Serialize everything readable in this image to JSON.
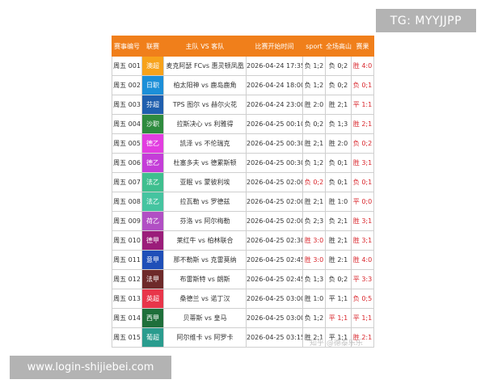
{
  "badges": {
    "tg": "TG: MYYJJPP",
    "url": "www.login-shijiebei.com"
  },
  "watermark": "知乎 @德泰乐乐",
  "table": {
    "headers": [
      "赛事编号",
      "联赛",
      "主队 VS 客队",
      "比赛开始时间",
      "sport",
      "全场高山",
      "赛果"
    ],
    "rows": [
      {
        "id": "周五 001",
        "league": "澳超",
        "color": "#f7a21b",
        "match": "麦克阿瑟 FCvs 惠灵顿凤凰",
        "time": "2026-04-24 17:35",
        "sport": "负 1;2",
        "full": "负 0;2",
        "result": "胜 4:0",
        "sport_red": false,
        "full_red": false,
        "result_red": true
      },
      {
        "id": "周五 002",
        "league": "日职",
        "color": "#1c8fd8",
        "match": "柏太阳神 vs 鹿岛鹿角",
        "time": "2026-04-24 18:00",
        "sport": "负 1;2",
        "full": "负 0;2",
        "result": "负 0;1",
        "sport_red": false,
        "full_red": false,
        "result_red": true
      },
      {
        "id": "周五 003",
        "league": "芬超",
        "color": "#1f5fae",
        "match": "TPS 图尔 vs 赫尔火花",
        "time": "2026-04-24 23:00",
        "sport": "胜 2:0",
        "full": "胜 2;1",
        "result": "平 1:1",
        "sport_red": false,
        "full_red": false,
        "result_red": true
      },
      {
        "id": "周五 004",
        "league": "沙职",
        "color": "#2e8b3e",
        "match": "拉斯决心 vs 利雅得",
        "time": "2026-04-25 00:10",
        "sport": "负 0;2",
        "full": "负 1;3",
        "result": "胜 2;1",
        "sport_red": false,
        "full_red": false,
        "result_red": true
      },
      {
        "id": "周五 005",
        "league": "德乙",
        "color": "#e23de0",
        "match": "凯泽 vs 不伦瑞克",
        "time": "2026-04-25 00:30",
        "sport": "胜 2;1",
        "full": "胜 2:0",
        "result": "负 0;2",
        "sport_red": false,
        "full_red": false,
        "result_red": true
      },
      {
        "id": "周五 006",
        "league": "德乙",
        "color": "#c43dd8",
        "match": "杜塞多夫 vs 德累斯顿",
        "time": "2026-04-25 00:30",
        "sport": "负 1;2",
        "full": "负 0;1",
        "result": "胜 3;1",
        "sport_red": false,
        "full_red": false,
        "result_red": true
      },
      {
        "id": "周五 007",
        "league": "法乙",
        "color": "#3fbf8f",
        "match": "亚眠 vs 蒙彼利埃",
        "time": "2026-04-25 02:00",
        "sport": "负 0;2",
        "full": "负 0;1",
        "result": "负 0;1",
        "sport_red": true,
        "full_red": false,
        "result_red": true
      },
      {
        "id": "周五 008",
        "league": "法乙",
        "color": "#45c4a0",
        "match": "拉瓦勒 vs 罗德兹",
        "time": "2026-04-25 02:00",
        "sport": "胜 2;1",
        "full": "胜 1:0",
        "result": "平 0;0",
        "sport_red": false,
        "full_red": false,
        "result_red": true
      },
      {
        "id": "周五 009",
        "league": "荷乙",
        "color": "#b14fc4",
        "match": "芬洛 vs 阿尔梅勒",
        "time": "2026-04-25 02:00",
        "sport": "负 2;3",
        "full": "负 2;1",
        "result": "胜 3;1",
        "sport_red": false,
        "full_red": false,
        "result_red": true
      },
      {
        "id": "周五 010",
        "league": "德甲",
        "color": "#9b1d7a",
        "match": "莱红牛 vs 柏林联合",
        "time": "2026-04-25 02:30",
        "sport": "胜 3:0",
        "full": "胜 2;1",
        "result": "胜 3;1",
        "sport_red": true,
        "full_red": false,
        "result_red": true
      },
      {
        "id": "周五 011",
        "league": "意甲",
        "color": "#1f4fb8",
        "match": "那不勒斯 vs 克雷莫纳",
        "time": "2026-04-25 02:45",
        "sport": "胜 3:0",
        "full": "胜 2:1",
        "result": "胜 4:0",
        "sport_red": true,
        "full_red": false,
        "result_red": true
      },
      {
        "id": "周五 012",
        "league": "法甲",
        "color": "#6e2a2a",
        "match": "布雷斯特 vs 朗斯",
        "time": "2026-04-25 02:45",
        "sport": "负 1;3",
        "full": "负 0;2",
        "result": "平 3:3",
        "sport_red": false,
        "full_red": false,
        "result_red": true
      },
      {
        "id": "周五 013",
        "league": "英超",
        "color": "#e8364a",
        "match": "桑德兰 vs 诺丁汉",
        "time": "2026-04-25 03:00",
        "sport": "胜 1:0",
        "full": "平 1;1",
        "result": "负 0;5",
        "sport_red": false,
        "full_red": false,
        "result_red": true
      },
      {
        "id": "周五 014",
        "league": "西甲",
        "color": "#1e6f3a",
        "match": "贝蒂斯 vs 皇马",
        "time": "2026-04-25 03:00",
        "sport": "负 1;2",
        "full": "平 1;1",
        "result": "平 1;1",
        "sport_red": false,
        "full_red": true,
        "result_red": true
      },
      {
        "id": "周五 015",
        "league": "葡超",
        "color": "#2a9c8e",
        "match": "阿尔维卡 vs 阿罗卡",
        "time": "2026-04-25 03:15",
        "sport": "胜 2;1",
        "full": "平 1;1",
        "result": "胜 2:1",
        "sport_red": false,
        "full_red": false,
        "result_red": true
      }
    ]
  }
}
